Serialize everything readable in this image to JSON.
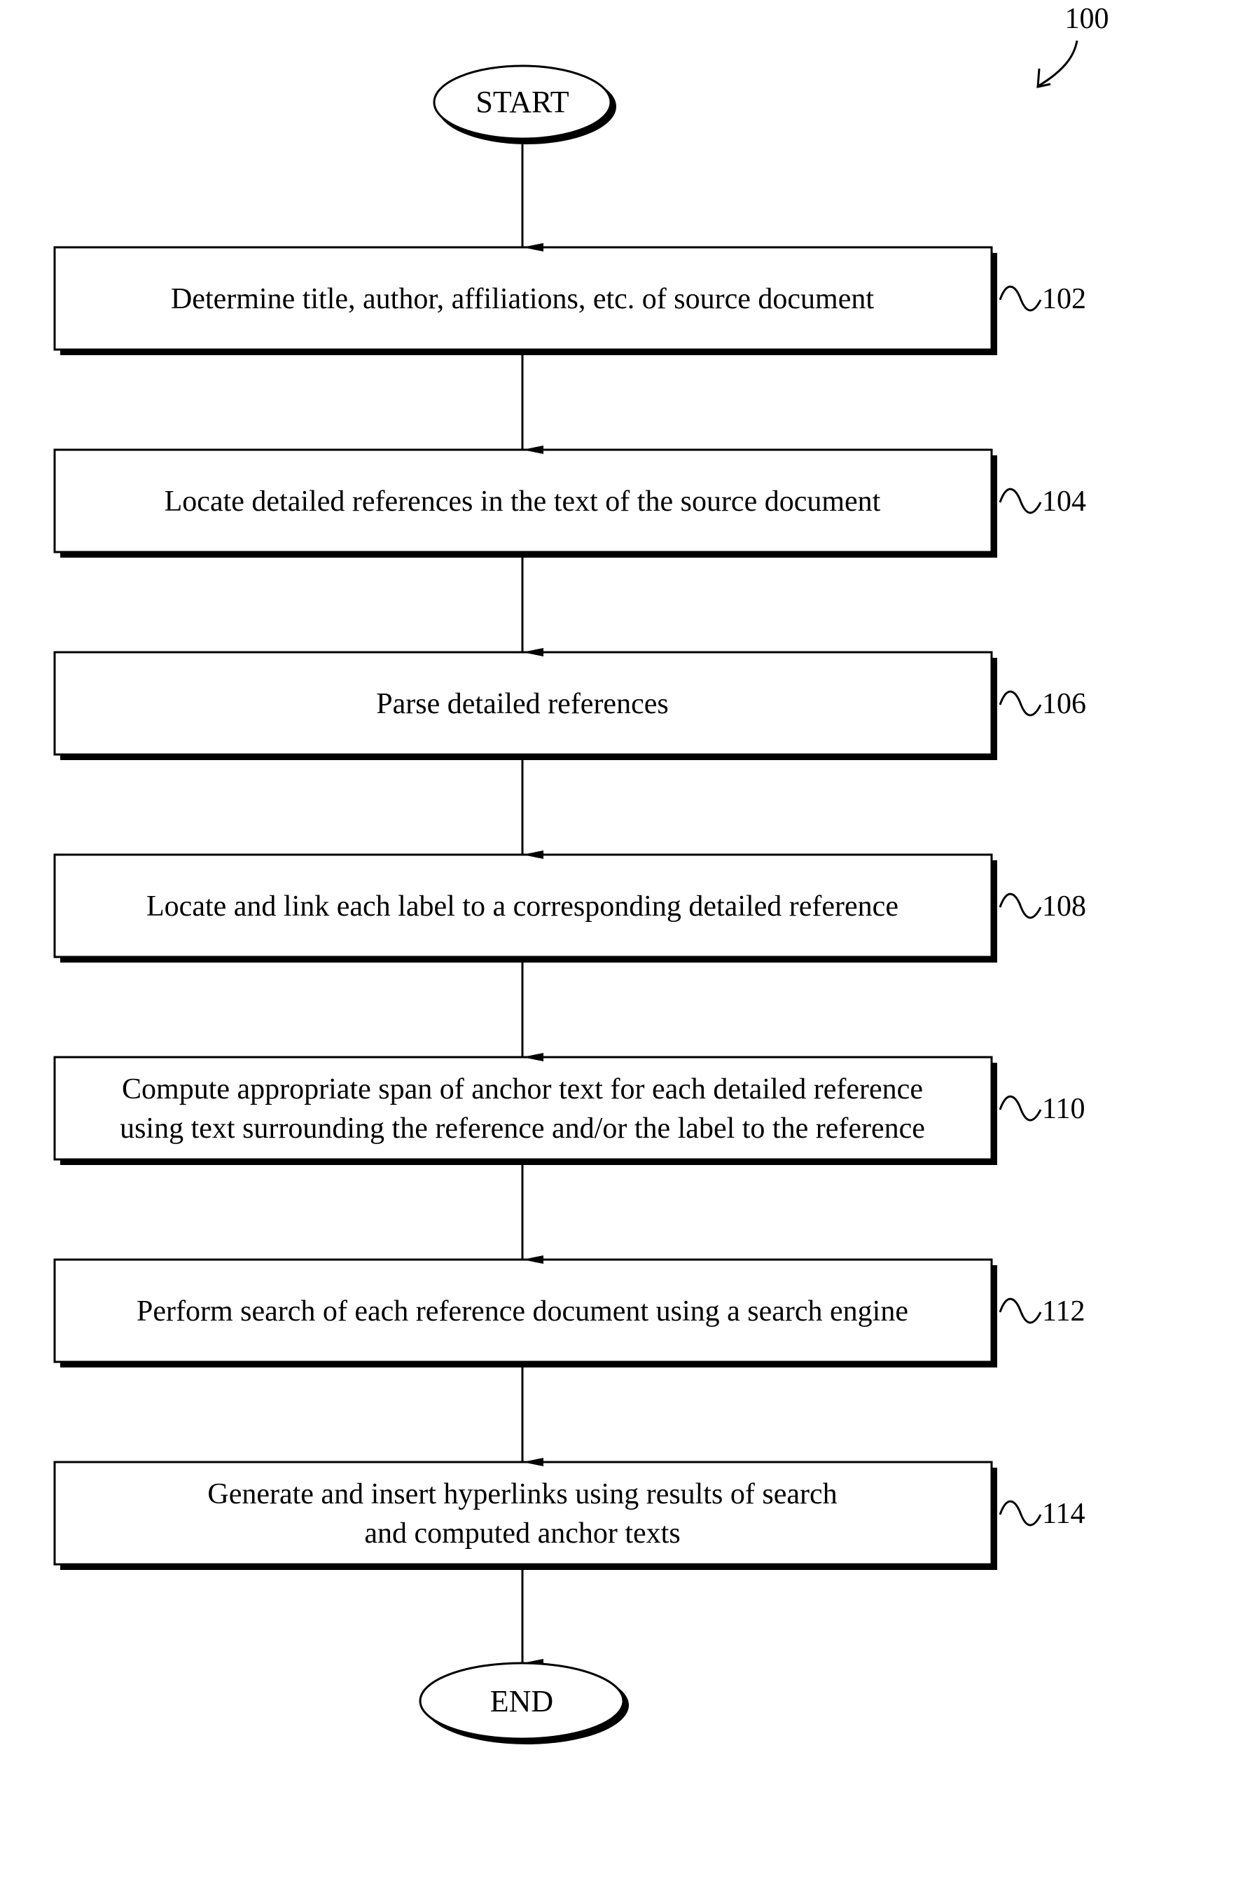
{
  "figure": {
    "reference_number": "100",
    "start_label": "START",
    "end_label": "END",
    "steps": [
      {
        "ref": "102",
        "lines": [
          "Determine title, author, affiliations, etc. of source document"
        ]
      },
      {
        "ref": "104",
        "lines": [
          "Locate detailed references in the text of the source document"
        ]
      },
      {
        "ref": "106",
        "lines": [
          "Parse detailed references"
        ]
      },
      {
        "ref": "108",
        "lines": [
          "Locate and link each label to a corresponding detailed reference"
        ]
      },
      {
        "ref": "110",
        "lines": [
          "Compute appropriate span of anchor text for each detailed reference",
          "using text surrounding the reference and/or the label to the reference"
        ]
      },
      {
        "ref": "112",
        "lines": [
          "Perform search of each reference document using a search engine"
        ]
      },
      {
        "ref": "114",
        "lines": [
          "Generate and insert hyperlinks using results of search",
          "and computed anchor texts"
        ]
      }
    ]
  }
}
